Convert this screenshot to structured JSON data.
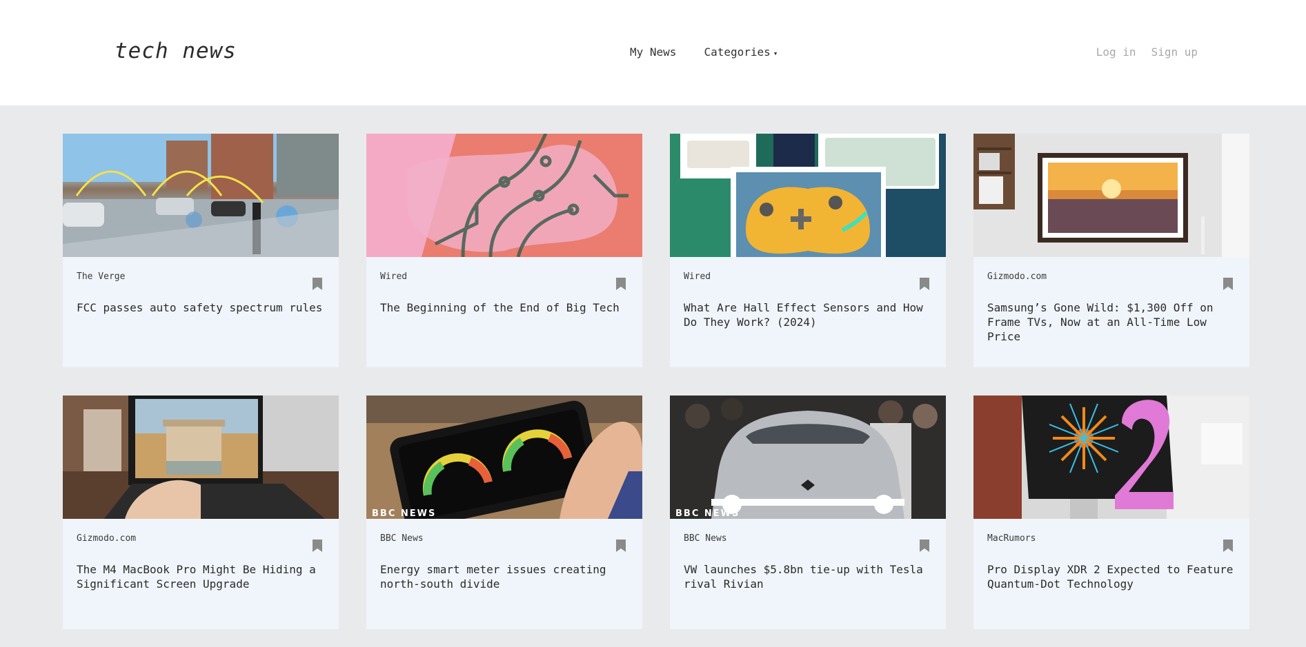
{
  "header": {
    "logo": "tech news",
    "nav": {
      "my_news": "My News",
      "categories": "Categories",
      "categories_caret": "▾"
    },
    "auth": {
      "login": "Log in",
      "signup": "Sign up"
    }
  },
  "articles": [
    {
      "source": "The Verge",
      "title": "FCC passes auto safety spectrum rules"
    },
    {
      "source": "Wired",
      "title": "The Beginning of the End of Big Tech"
    },
    {
      "source": "Wired",
      "title": "What Are Hall Effect Sensors and How Do They Work? (2024)"
    },
    {
      "source": "Gizmodo.com",
      "title": "Samsung’s Gone Wild: $1,300 Off on Frame TVs, Now at an All-Time Low Price"
    },
    {
      "source": "Gizmodo.com",
      "title": "The M4 MacBook Pro Might Be Hiding a Significant Screen Upgrade"
    },
    {
      "source": "BBC News",
      "title": "Energy smart meter issues creating north-south divide",
      "image_tag": "BBC NEWS"
    },
    {
      "source": "BBC News",
      "title": "VW launches $5.8bn tie-up with Tesla rival Rivian",
      "image_tag": "BBC NEWS"
    },
    {
      "source": "MacRumors",
      "title": "Pro Display XDR 2 Expected to Feature Quantum-Dot Technology"
    }
  ],
  "colors": {
    "page_bg": "#e9eaeb",
    "card_bg": "#eff5fa",
    "bookmark": "#8a8a8a",
    "auth_text": "#a9a9a9"
  }
}
